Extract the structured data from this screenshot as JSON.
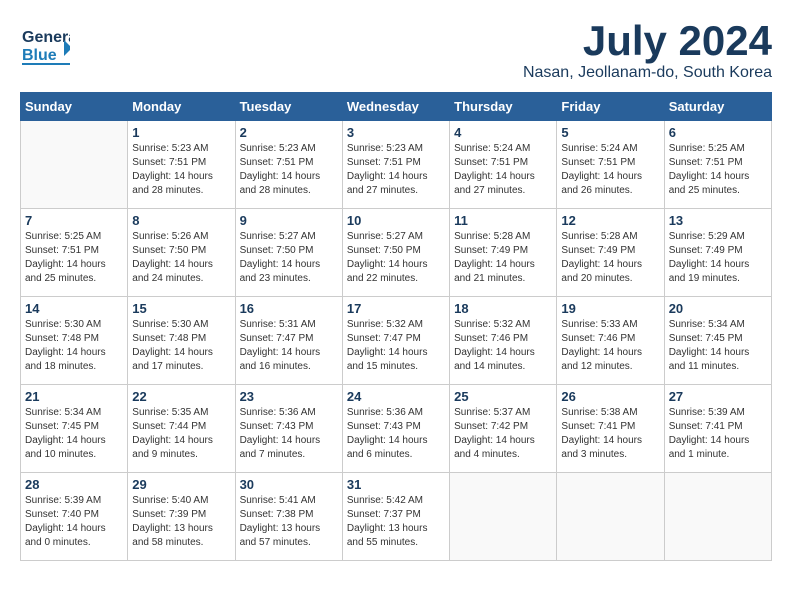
{
  "header": {
    "logo": {
      "general": "General",
      "blue": "Blue"
    },
    "month": "July 2024",
    "location": "Nasan, Jeollanam-do, South Korea"
  },
  "calendar": {
    "days": [
      "Sunday",
      "Monday",
      "Tuesday",
      "Wednesday",
      "Thursday",
      "Friday",
      "Saturday"
    ],
    "weeks": [
      [
        {
          "day": "",
          "info": ""
        },
        {
          "day": "1",
          "info": "Sunrise: 5:23 AM\nSunset: 7:51 PM\nDaylight: 14 hours\nand 28 minutes."
        },
        {
          "day": "2",
          "info": "Sunrise: 5:23 AM\nSunset: 7:51 PM\nDaylight: 14 hours\nand 28 minutes."
        },
        {
          "day": "3",
          "info": "Sunrise: 5:23 AM\nSunset: 7:51 PM\nDaylight: 14 hours\nand 27 minutes."
        },
        {
          "day": "4",
          "info": "Sunrise: 5:24 AM\nSunset: 7:51 PM\nDaylight: 14 hours\nand 27 minutes."
        },
        {
          "day": "5",
          "info": "Sunrise: 5:24 AM\nSunset: 7:51 PM\nDaylight: 14 hours\nand 26 minutes."
        },
        {
          "day": "6",
          "info": "Sunrise: 5:25 AM\nSunset: 7:51 PM\nDaylight: 14 hours\nand 25 minutes."
        }
      ],
      [
        {
          "day": "7",
          "info": "Sunrise: 5:25 AM\nSunset: 7:51 PM\nDaylight: 14 hours\nand 25 minutes."
        },
        {
          "day": "8",
          "info": "Sunrise: 5:26 AM\nSunset: 7:50 PM\nDaylight: 14 hours\nand 24 minutes."
        },
        {
          "day": "9",
          "info": "Sunrise: 5:27 AM\nSunset: 7:50 PM\nDaylight: 14 hours\nand 23 minutes."
        },
        {
          "day": "10",
          "info": "Sunrise: 5:27 AM\nSunset: 7:50 PM\nDaylight: 14 hours\nand 22 minutes."
        },
        {
          "day": "11",
          "info": "Sunrise: 5:28 AM\nSunset: 7:49 PM\nDaylight: 14 hours\nand 21 minutes."
        },
        {
          "day": "12",
          "info": "Sunrise: 5:28 AM\nSunset: 7:49 PM\nDaylight: 14 hours\nand 20 minutes."
        },
        {
          "day": "13",
          "info": "Sunrise: 5:29 AM\nSunset: 7:49 PM\nDaylight: 14 hours\nand 19 minutes."
        }
      ],
      [
        {
          "day": "14",
          "info": "Sunrise: 5:30 AM\nSunset: 7:48 PM\nDaylight: 14 hours\nand 18 minutes."
        },
        {
          "day": "15",
          "info": "Sunrise: 5:30 AM\nSunset: 7:48 PM\nDaylight: 14 hours\nand 17 minutes."
        },
        {
          "day": "16",
          "info": "Sunrise: 5:31 AM\nSunset: 7:47 PM\nDaylight: 14 hours\nand 16 minutes."
        },
        {
          "day": "17",
          "info": "Sunrise: 5:32 AM\nSunset: 7:47 PM\nDaylight: 14 hours\nand 15 minutes."
        },
        {
          "day": "18",
          "info": "Sunrise: 5:32 AM\nSunset: 7:46 PM\nDaylight: 14 hours\nand 14 minutes."
        },
        {
          "day": "19",
          "info": "Sunrise: 5:33 AM\nSunset: 7:46 PM\nDaylight: 14 hours\nand 12 minutes."
        },
        {
          "day": "20",
          "info": "Sunrise: 5:34 AM\nSunset: 7:45 PM\nDaylight: 14 hours\nand 11 minutes."
        }
      ],
      [
        {
          "day": "21",
          "info": "Sunrise: 5:34 AM\nSunset: 7:45 PM\nDaylight: 14 hours\nand 10 minutes."
        },
        {
          "day": "22",
          "info": "Sunrise: 5:35 AM\nSunset: 7:44 PM\nDaylight: 14 hours\nand 9 minutes."
        },
        {
          "day": "23",
          "info": "Sunrise: 5:36 AM\nSunset: 7:43 PM\nDaylight: 14 hours\nand 7 minutes."
        },
        {
          "day": "24",
          "info": "Sunrise: 5:36 AM\nSunset: 7:43 PM\nDaylight: 14 hours\nand 6 minutes."
        },
        {
          "day": "25",
          "info": "Sunrise: 5:37 AM\nSunset: 7:42 PM\nDaylight: 14 hours\nand 4 minutes."
        },
        {
          "day": "26",
          "info": "Sunrise: 5:38 AM\nSunset: 7:41 PM\nDaylight: 14 hours\nand 3 minutes."
        },
        {
          "day": "27",
          "info": "Sunrise: 5:39 AM\nSunset: 7:41 PM\nDaylight: 14 hours\nand 1 minute."
        }
      ],
      [
        {
          "day": "28",
          "info": "Sunrise: 5:39 AM\nSunset: 7:40 PM\nDaylight: 14 hours\nand 0 minutes."
        },
        {
          "day": "29",
          "info": "Sunrise: 5:40 AM\nSunset: 7:39 PM\nDaylight: 13 hours\nand 58 minutes."
        },
        {
          "day": "30",
          "info": "Sunrise: 5:41 AM\nSunset: 7:38 PM\nDaylight: 13 hours\nand 57 minutes."
        },
        {
          "day": "31",
          "info": "Sunrise: 5:42 AM\nSunset: 7:37 PM\nDaylight: 13 hours\nand 55 minutes."
        },
        {
          "day": "",
          "info": ""
        },
        {
          "day": "",
          "info": ""
        },
        {
          "day": "",
          "info": ""
        }
      ]
    ]
  }
}
